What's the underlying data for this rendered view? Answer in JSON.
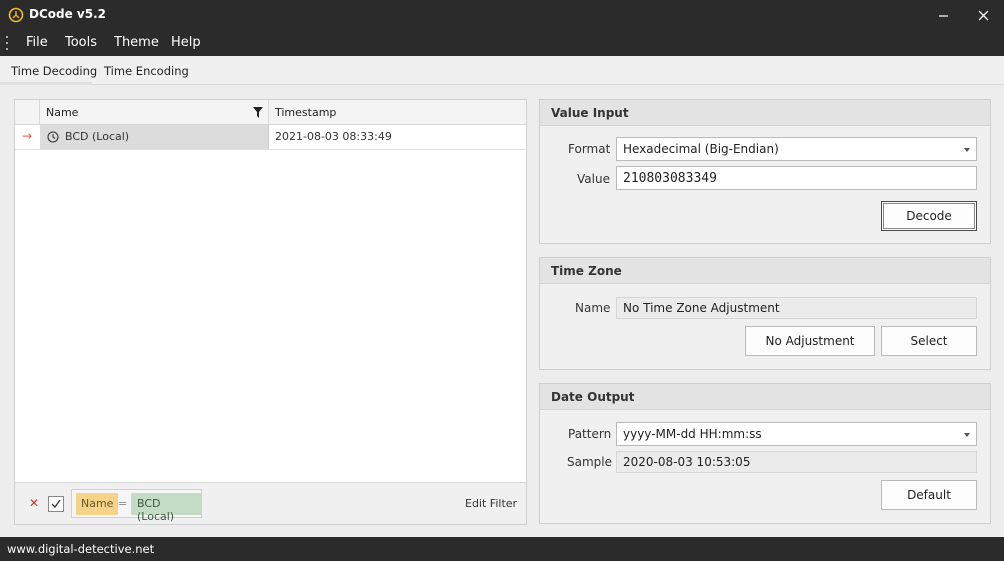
{
  "window": {
    "title": "DCode v5.2",
    "app_icon": "dcode-logo-icon",
    "minimize_icon": "minimize-icon",
    "close_icon": "close-icon"
  },
  "menu": {
    "items": [
      "File",
      "Tools",
      "Theme",
      "Help"
    ]
  },
  "tabs": [
    {
      "label": "Time Decoding",
      "active": true
    },
    {
      "label": "Time Encoding",
      "active": false
    }
  ],
  "grid": {
    "columns": {
      "name": "Name",
      "timestamp": "Timestamp"
    },
    "rows": [
      {
        "indicator": "→",
        "icon": "clock-icon",
        "name": "BCD (Local)",
        "timestamp": "2021-08-03 08:33:49"
      }
    ],
    "filter": {
      "clear_icon": "✕",
      "enabled": true,
      "field": "Name",
      "operator": "=",
      "value": "BCD (Local)",
      "edit_label": "Edit Filter"
    }
  },
  "value_input": {
    "title": "Value Input",
    "format_label": "Format",
    "format_value": "Hexadecimal (Big-Endian)",
    "value_label": "Value",
    "value": "210803083349",
    "decode_label": "Decode"
  },
  "time_zone": {
    "title": "Time Zone",
    "name_label": "Name",
    "name_value": "No Time Zone Adjustment",
    "no_adjustment_label": "No Adjustment",
    "select_label": "Select"
  },
  "date_output": {
    "title": "Date Output",
    "pattern_label": "Pattern",
    "pattern_value": "yyyy-MM-dd HH:mm:ss",
    "sample_label": "Sample",
    "sample_value": "2020-08-03 10:53:05",
    "default_label": "Default"
  },
  "status": {
    "text": "www.digital-detective.net"
  },
  "colors": {
    "chrome": "#2b2b2b",
    "filter_field": "#f5d48a",
    "filter_value": "#c4dcc6",
    "row_indicator": "#e05a4a",
    "clear_filter": "#d9342b"
  }
}
